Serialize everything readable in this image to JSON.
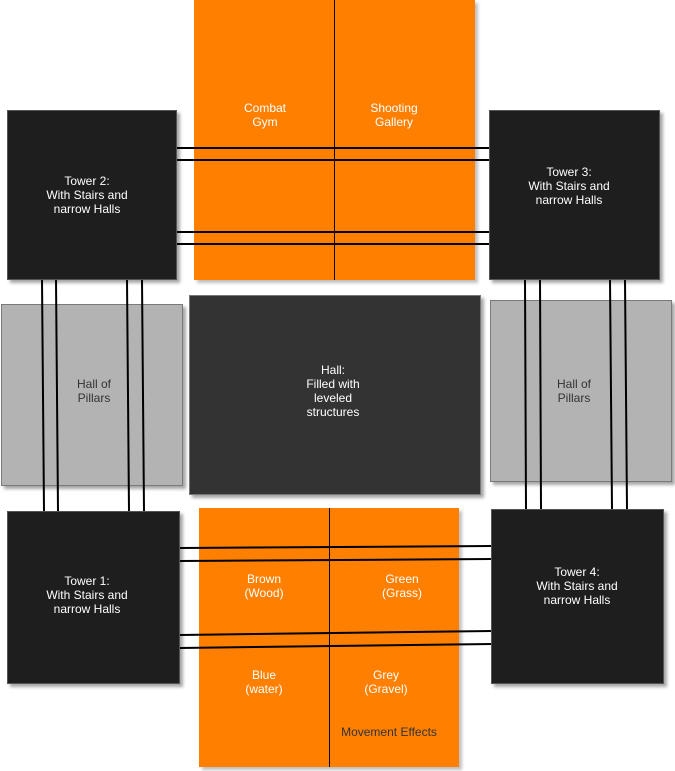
{
  "diagram": {
    "combat_gym": "Combat\nGym",
    "shooting_gallery": "Shooting\nGallery",
    "tower2": "Tower 2:\nWith Stairs and\nnarrow Halls",
    "tower3": "Tower 3:\nWith Stairs and\nnarrow Halls",
    "tower1": "Tower 1:\nWith Stairs and\nnarrow Halls",
    "tower4": "Tower 4:\nWith Stairs and\nnarrow Halls",
    "pillars_left": "Hall of\nPillars",
    "pillars_right": "Hall of\nPillars",
    "center_hall": "Hall:\nFilled with\nleveled\nstructures",
    "brown": "Brown\n(Wood)",
    "green": "Green\n(Grass)",
    "blue": "Blue\n(water)",
    "grey": "Grey\n(Gravel)",
    "movement_effects": "Movement Effects"
  },
  "colors": {
    "tower": "#1e1e1e",
    "orange": "#ff8000",
    "pillars": "#b3b3b3",
    "hall": "#333333"
  }
}
